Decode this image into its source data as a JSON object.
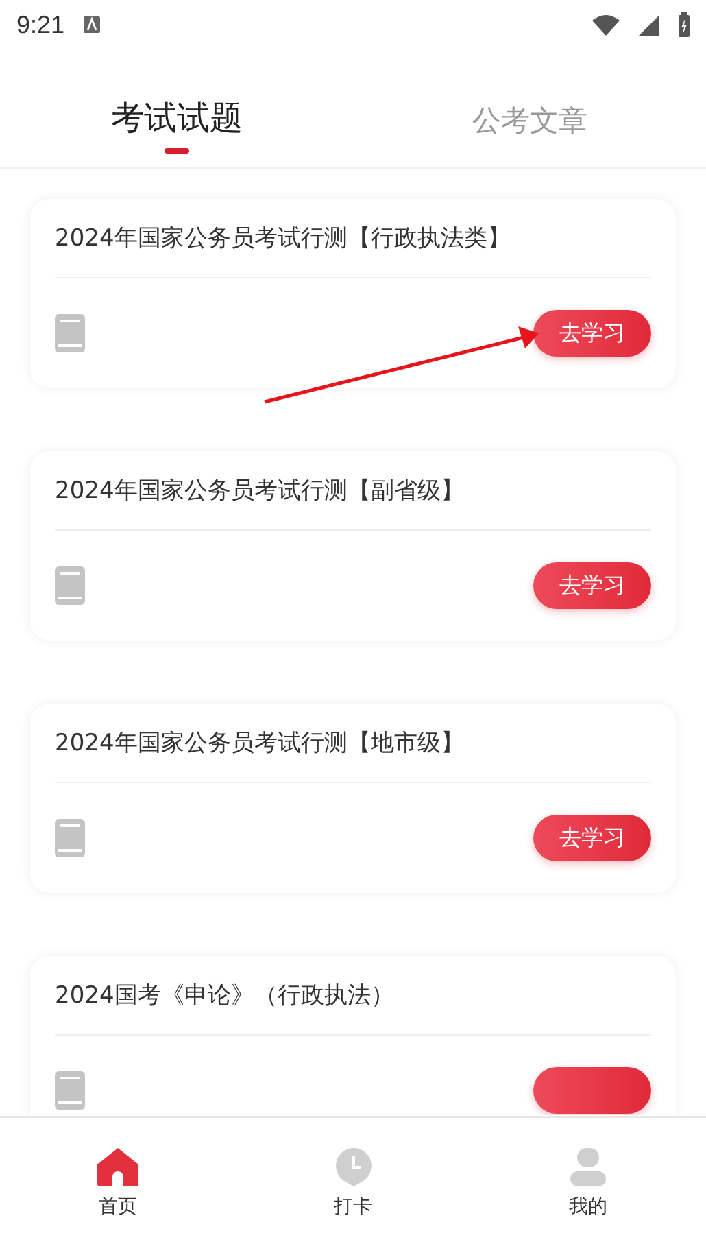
{
  "status_bar": {
    "time": "9:21"
  },
  "tabs": [
    {
      "label": "考试试题",
      "selected": true
    },
    {
      "label": "公考文章",
      "selected": false
    }
  ],
  "cards": [
    {
      "title": "2024年国家公务员考试行测【行政执法类】",
      "button": "去学习"
    },
    {
      "title": "2024年国家公务员考试行测【副省级】",
      "button": "去学习"
    },
    {
      "title": "2024年国家公务员考试行测【地市级】",
      "button": "去学习"
    },
    {
      "title": "2024国考《申论》（行政执法）"
    }
  ],
  "bottom_nav": [
    {
      "label": "首页",
      "kind": "home",
      "selected": true
    },
    {
      "label": "打卡",
      "kind": "clock",
      "selected": false
    },
    {
      "label": "我的",
      "kind": "person",
      "selected": false
    }
  ]
}
